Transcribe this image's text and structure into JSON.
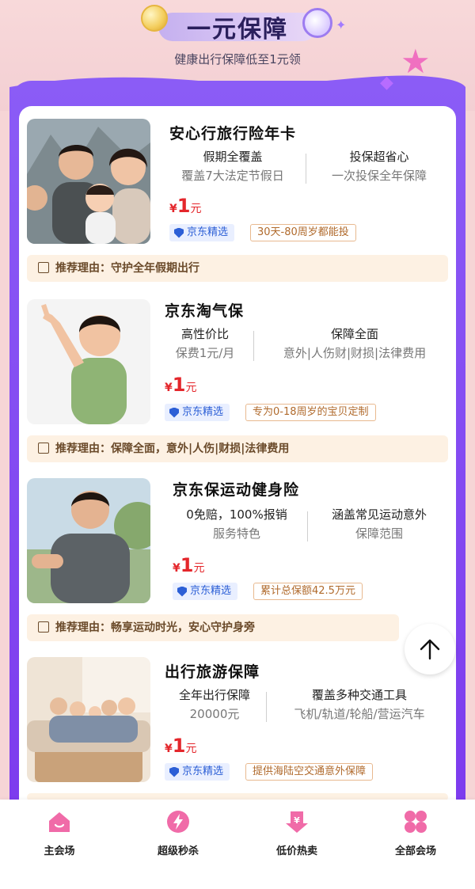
{
  "header": {
    "title": "一元保障",
    "subtitle": "健康出行保障低至1元领"
  },
  "colors": {
    "accent": "#7c3aed",
    "price": "#e4262b",
    "brand": "#2c5fd6",
    "tag": "#b06a2c"
  },
  "products": [
    {
      "name": "安心行旅行险年卡",
      "features": [
        {
          "title": "假期全覆盖",
          "sub": "覆盖7大法定节假日"
        },
        {
          "title": "投保超省心",
          "sub": "一次投保全年保障"
        }
      ],
      "price_currency": "¥",
      "price_value": "1",
      "price_unit": "元",
      "brand": "京东精选",
      "tag": "30天-80周岁都能投",
      "reason": "推荐理由：守护全年假期出行"
    },
    {
      "name": "京东淘气保",
      "features": [
        {
          "title": "高性价比",
          "sub": "保费1元/月"
        },
        {
          "title": "保障全面",
          "sub": "意外|人伤财|财损|法律费用"
        }
      ],
      "price_currency": "¥",
      "price_value": "1",
      "price_unit": "元",
      "brand": "京东精选",
      "tag": "专为0-18周岁的宝贝定制",
      "reason": "推荐理由：保障全面，意外|人伤|财损|法律费用"
    },
    {
      "name": "京东保运动健身险",
      "features": [
        {
          "title": "0免赔，100%报销",
          "sub": "服务特色"
        },
        {
          "title": "涵盖常见运动意外",
          "sub": "保障范围"
        }
      ],
      "price_currency": "¥",
      "price_value": "1",
      "price_unit": "元",
      "brand": "京东精选",
      "tag": "累计总保额42.5万元",
      "reason": "推荐理由：畅享运动时光，安心守护身旁"
    },
    {
      "name": "出行旅游保障",
      "features": [
        {
          "title": "全年出行保障",
          "sub": "20000元"
        },
        {
          "title": "覆盖多种交通工具",
          "sub": "飞机/轨道/轮船/营运汽车"
        }
      ],
      "price_currency": "¥",
      "price_value": "1",
      "price_unit": "元",
      "brand": "京东精选",
      "tag": "提供海陆空交通意外保障"
    }
  ],
  "nav": {
    "items": [
      {
        "label": "主会场",
        "icon": "home-icon"
      },
      {
        "label": "超级秒杀",
        "icon": "lightning-icon"
      },
      {
        "label": "低价热卖",
        "icon": "price-down-icon"
      },
      {
        "label": "全部会场",
        "icon": "grid-icon"
      }
    ]
  }
}
